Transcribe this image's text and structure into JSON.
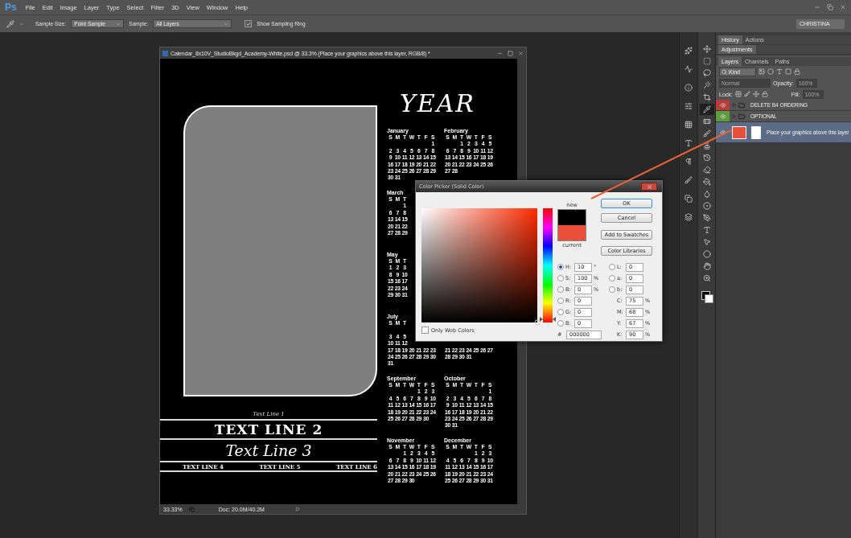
{
  "app_logo": "Ps",
  "menu": [
    "File",
    "Edit",
    "Image",
    "Layer",
    "Type",
    "Select",
    "Filter",
    "3D",
    "View",
    "Window",
    "Help"
  ],
  "options_bar": {
    "sample_size_label": "Sample Size:",
    "sample_size": "Point Sample",
    "sample_label": "Sample:",
    "sample": "All Layers",
    "sampling_ring": {
      "label": "Show Sampling Ring",
      "checked": true
    },
    "workspace": "CHRISTINA"
  },
  "document": {
    "title": "Calendar_8x10V_StudioBkgd_Academy-White.psd @ 33.3% (Place your graphics above this layer, RGB/8) *",
    "zoom": "33.33%",
    "doc_size": "Doc: 20.0M/40.2M",
    "year": "YEAR",
    "text_line_1": "Text Line 1",
    "text_line_2": "TEXT LINE 2",
    "text_line_3": "Text Line 3",
    "bottom_lines": [
      "TEXT LINE 4",
      "TEXT LINE 5",
      "TEXT LINE 6"
    ],
    "calendar": [
      [
        {
          "kind": "full",
          "name": "January",
          "days": [
            "S",
            "M",
            "T",
            "W",
            "T",
            "F",
            "S"
          ],
          "weeks": [
            [
              "1"
            ],
            [
              "2",
              "3",
              "4",
              "5",
              "6",
              "7",
              "8"
            ],
            [
              "9",
              "10",
              "11",
              "12",
              "13",
              "14",
              "15"
            ],
            [
              "16",
              "17",
              "18",
              "19",
              "20",
              "21",
              "22"
            ],
            [
              "23",
              "24",
              "25",
              "26",
              "27",
              "28",
              "29"
            ],
            [
              "30",
              "31"
            ]
          ]
        },
        {
          "kind": "full",
          "name": "February",
          "days": [
            "S",
            "M",
            "T",
            "W",
            "T",
            "F",
            "S"
          ],
          "weeks": [
            [
              "1",
              "2",
              "3",
              "4",
              "5"
            ],
            [
              "6",
              "7",
              "8",
              "9",
              "10",
              "11",
              "12"
            ],
            [
              "13",
              "14",
              "15",
              "16",
              "17",
              "18",
              "19"
            ],
            [
              "20",
              "21",
              "22",
              "23",
              "24",
              "25",
              "26"
            ],
            [
              "27",
              "28"
            ]
          ]
        }
      ],
      [
        {
          "kind": "full",
          "name": "March",
          "days": [
            "S",
            "M",
            "T"
          ],
          "weeks": [
            [
              "1"
            ],
            [
              "6",
              "7",
              "8"
            ],
            [
              "13",
              "14",
              "15"
            ],
            [
              "20",
              "21",
              "22"
            ],
            [
              "27",
              "28",
              "29"
            ]
          ]
        }
      ],
      [
        {
          "kind": "full",
          "name": "May",
          "days": [
            "S",
            "M",
            "T"
          ],
          "weeks": [
            [
              "1",
              "2",
              "3"
            ],
            [
              "8",
              "9",
              "10"
            ],
            [
              "15",
              "16",
              "17"
            ],
            [
              "22",
              "23",
              "24"
            ],
            [
              "29",
              "30",
              "31"
            ]
          ]
        }
      ],
      [
        {
          "kind": "gapped",
          "name": "July",
          "days": [
            "S",
            "M",
            "T"
          ],
          "weeks": [
            [
              "3",
              "4",
              "5"
            ],
            [
              "10",
              "11",
              "12"
            ],
            [
              "17",
              "18",
              "19",
              "20",
              "21",
              "22",
              "23"
            ],
            [
              "24",
              "25",
              "26",
              "27",
              "28",
              "29",
              "30"
            ],
            [
              "31"
            ]
          ]
        },
        {
          "kind": "tail",
          "weeks": [
            [
              "21",
              "22",
              "23",
              "24",
              "25",
              "26",
              "27"
            ],
            [
              "28",
              "29",
              "30",
              "31"
            ]
          ]
        }
      ],
      [
        {
          "kind": "full",
          "name": "September",
          "days": [
            "S",
            "M",
            "T",
            "W",
            "T",
            "F",
            "S"
          ],
          "weeks": [
            [
              "1",
              "2",
              "3"
            ],
            [
              "4",
              "5",
              "6",
              "7",
              "8",
              "9",
              "10"
            ],
            [
              "11",
              "12",
              "13",
              "14",
              "15",
              "16",
              "17"
            ],
            [
              "18",
              "19",
              "20",
              "21",
              "22",
              "23",
              "24"
            ],
            [
              "25",
              "26",
              "27",
              "28",
              "29",
              "30"
            ]
          ]
        },
        {
          "kind": "full",
          "name": "October",
          "days": [
            "S",
            "M",
            "T",
            "W",
            "T",
            "F",
            "S"
          ],
          "weeks": [
            [
              "1"
            ],
            [
              "2",
              "3",
              "4",
              "5",
              "6",
              "7",
              "8"
            ],
            [
              "9",
              "10",
              "11",
              "12",
              "13",
              "14",
              "15"
            ],
            [
              "16",
              "17",
              "18",
              "19",
              "20",
              "21",
              "22"
            ],
            [
              "23",
              "24",
              "25",
              "26",
              "27",
              "28",
              "29"
            ],
            [
              "30",
              "31"
            ]
          ]
        }
      ],
      [
        {
          "kind": "full",
          "name": "November",
          "days": [
            "S",
            "M",
            "T",
            "W",
            "T",
            "F",
            "S"
          ],
          "weeks": [
            [
              "1",
              "2",
              "3",
              "4",
              "5"
            ],
            [
              "6",
              "7",
              "8",
              "9",
              "10",
              "11",
              "12"
            ],
            [
              "13",
              "14",
              "15",
              "16",
              "17",
              "18",
              "19"
            ],
            [
              "20",
              "21",
              "22",
              "23",
              "24",
              "25",
              "26"
            ],
            [
              "27",
              "28",
              "29",
              "30"
            ]
          ]
        },
        {
          "kind": "full",
          "name": "December",
          "days": [
            "S",
            "M",
            "T",
            "W",
            "T",
            "F",
            "S"
          ],
          "weeks": [
            [
              "1",
              "2",
              "3"
            ],
            [
              "4",
              "5",
              "6",
              "7",
              "8",
              "9",
              "10"
            ],
            [
              "11",
              "12",
              "13",
              "14",
              "15",
              "16",
              "17"
            ],
            [
              "18",
              "19",
              "20",
              "21",
              "22",
              "23",
              "24"
            ],
            [
              "25",
              "26",
              "27",
              "28",
              "29",
              "30",
              "31"
            ]
          ]
        }
      ]
    ]
  },
  "color_picker": {
    "title": "Color Picker (Solid Color)",
    "hue": {
      "level": 0.03
    },
    "swatches": [
      {
        "label": "new",
        "color": "#000000"
      },
      {
        "label": "current",
        "color": "#e8503a"
      }
    ],
    "buttons": [
      {
        "label": "OK",
        "default": true
      },
      {
        "label": "Cancel",
        "default": false
      },
      {
        "label": "Add to Swatches",
        "default": false
      },
      {
        "label": "Color Libraries",
        "default": false
      }
    ],
    "fields_left": [
      {
        "kind": "radio",
        "label": "H:",
        "value": "10",
        "unit": "°",
        "selected": true
      },
      {
        "kind": "radio",
        "label": "S:",
        "value": "100",
        "unit": "%",
        "selected": false
      },
      {
        "kind": "radio",
        "label": "B:",
        "value": "0",
        "unit": "%",
        "selected": false
      },
      {
        "kind": "radio",
        "label": "R:",
        "value": "0",
        "selected": false
      },
      {
        "kind": "radio",
        "label": "G:",
        "value": "0",
        "selected": false
      },
      {
        "kind": "radio",
        "label": "B:",
        "value": "0",
        "selected": false
      },
      {
        "kind": "hex",
        "label": "#",
        "value": "000000"
      }
    ],
    "fields_right": [
      {
        "kind": "radio",
        "label": "L:",
        "value": "0",
        "selected": false
      },
      {
        "kind": "radio",
        "label": "a:",
        "value": "0",
        "selected": false
      },
      {
        "kind": "radio",
        "label": "b:",
        "value": "0",
        "selected": false
      },
      {
        "kind": "plain",
        "label": "C:",
        "value": "75",
        "unit": "%"
      },
      {
        "kind": "plain",
        "label": "M:",
        "value": "68",
        "unit": "%"
      },
      {
        "kind": "plain",
        "label": "Y:",
        "value": "67",
        "unit": "%"
      },
      {
        "kind": "plain",
        "label": "K:",
        "value": "90",
        "unit": "%"
      }
    ],
    "web_colors": {
      "label": "Only Web Colors",
      "checked": false
    }
  },
  "dock_icons": [
    {
      "kind": "sparkle"
    },
    {
      "kind": "histogram"
    },
    {
      "kind": "info"
    },
    {
      "kind": "adjust"
    },
    {
      "kind": "swatches"
    },
    {
      "kind": "character"
    },
    {
      "kind": "paragraph"
    },
    {
      "kind": "brush-preset"
    },
    {
      "kind": "clone-source"
    },
    {
      "kind": "layer-comps"
    }
  ],
  "tools": [
    {
      "kind": "move",
      "selected": false
    },
    {
      "kind": "marquee",
      "selected": false
    },
    {
      "kind": "lasso",
      "selected": false
    },
    {
      "kind": "wand",
      "selected": false
    },
    {
      "kind": "crop",
      "selected": false
    },
    {
      "kind": "eyedropper",
      "selected": true
    },
    {
      "kind": "healing",
      "selected": false
    },
    {
      "kind": "brush",
      "selected": false
    },
    {
      "kind": "stamp",
      "selected": false
    },
    {
      "kind": "history",
      "selected": false
    },
    {
      "kind": "eraser",
      "selected": false
    },
    {
      "kind": "bucket",
      "selected": false
    },
    {
      "kind": "blur",
      "selected": false
    },
    {
      "kind": "dodge",
      "selected": false
    },
    {
      "kind": "pen",
      "selected": false
    },
    {
      "kind": "type",
      "selected": false
    },
    {
      "kind": "select",
      "selected": false
    },
    {
      "kind": "shape",
      "selected": false
    },
    {
      "kind": "hand",
      "selected": false
    },
    {
      "kind": "zoom",
      "selected": false
    }
  ],
  "panels": {
    "top_tabs": [
      {
        "label": "History",
        "selected": true
      },
      {
        "label": "Actions",
        "selected": false
      }
    ],
    "adjustments": "Adjustments",
    "layer_tabs": [
      {
        "label": "Layers",
        "selected": true
      },
      {
        "label": "Channels",
        "selected": false
      },
      {
        "label": "Paths",
        "selected": false
      }
    ],
    "filter": {
      "placeholder": "Kind"
    },
    "blend_mode": {
      "value": "Normal",
      "disabled": true
    },
    "opacity": {
      "label": "Opacity:",
      "value": "100%",
      "disabled": true
    },
    "lock_label": "Lock:",
    "fill": {
      "label": "Fill:",
      "value": "100%",
      "disabled": true
    },
    "layers": [
      {
        "kind": "group",
        "name": "DELETE B4 ORDERING",
        "color": "#b83b3b",
        "selected": false
      },
      {
        "kind": "group",
        "name": "OPTIONAL",
        "color": "#5c9c3c",
        "selected": false
      },
      {
        "kind": "fill",
        "name": "Place your graphics above this layer",
        "selected": true
      }
    ]
  }
}
